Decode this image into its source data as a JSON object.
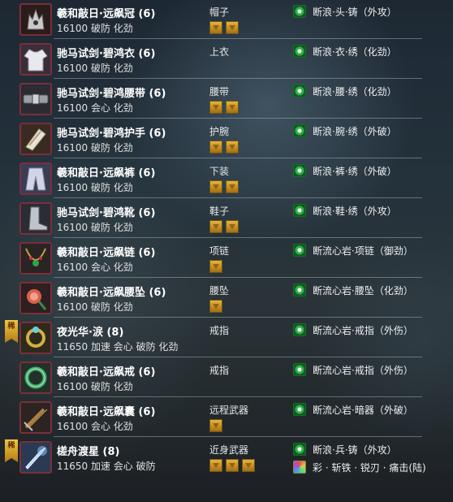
{
  "items": [
    {
      "name": "羲和敲日·远飙冠 (6)",
      "stats": "16100 破防 化劲",
      "slot": "帽子",
      "gems": 2,
      "forge": "断浪·头·铸（外攻）",
      "icon": "crown-helmet-icon",
      "badge": ""
    },
    {
      "name": "驰马试剑·碧鸿衣 (6)",
      "stats": "16100 破防 化劲",
      "slot": "上衣",
      "gems": 0,
      "forge": "断浪·衣·绣（化劲）",
      "icon": "robe-icon",
      "badge": ""
    },
    {
      "name": "驰马试剑·碧鸿腰带 (6)",
      "stats": "16100 会心 化劲",
      "slot": "腰带",
      "gems": 2,
      "forge": "断浪·腰·绣（化劲）",
      "icon": "belt-icon",
      "badge": ""
    },
    {
      "name": "驰马试剑·碧鸿护手 (6)",
      "stats": "16100 破防 化劲",
      "slot": "护腕",
      "gems": 2,
      "forge": "断浪·腕·绣（外破）",
      "icon": "bracer-icon",
      "badge": ""
    },
    {
      "name": "羲和敲日·远飙裤 (6)",
      "stats": "16100 破防 化劲",
      "slot": "下装",
      "gems": 2,
      "forge": "断浪·裤·绣（外破）",
      "icon": "pants-icon",
      "badge": ""
    },
    {
      "name": "驰马试剑·碧鸿靴 (6)",
      "stats": "16100 破防 化劲",
      "slot": "鞋子",
      "gems": 2,
      "forge": "断浪·鞋·绣（外攻）",
      "icon": "boots-icon",
      "badge": ""
    },
    {
      "name": "羲和敲日·远飙链 (6)",
      "stats": "16100 会心 化劲",
      "slot": "项链",
      "gems": 1,
      "forge": "断流心岩·项链（御劲）",
      "icon": "necklace-icon",
      "badge": ""
    },
    {
      "name": "羲和敲日·远飙腰坠 (6)",
      "stats": "16100 破防 化劲",
      "slot": "腰坠",
      "gems": 1,
      "forge": "断流心岩·腰坠（化劲）",
      "icon": "pendant-icon",
      "badge": ""
    },
    {
      "name": "夜光华·涙 (8)",
      "stats": "11650 加速 会心 破防 化劲",
      "slot": "戒指",
      "gems": 0,
      "forge": "断流心岩·戒指（外伤）",
      "icon": "ring-icon",
      "badge": "稀"
    },
    {
      "name": "羲和敲日·远飙戒 (6)",
      "stats": "16100 破防 化劲",
      "slot": "戒指",
      "gems": 0,
      "forge": "断流心岩·戒指（外伤）",
      "icon": "jade-ring-icon",
      "badge": ""
    },
    {
      "name": "羲和敲日·远飙囊 (6)",
      "stats": "16100 会心 化劲",
      "slot": "远程武器",
      "gems": 1,
      "forge": "断流心岩·暗器（外破）",
      "icon": "quiver-icon",
      "badge": ""
    },
    {
      "name": "槎舟渡星 (8)",
      "stats": "11650 加速 会心 破防",
      "slot": "近身武器",
      "gems": 3,
      "forge": "断浪·兵·铸（外攻）",
      "forge2": "彩 · 斩铁 · 锐刃 · 痛击(陆)",
      "icon": "weapon-icon",
      "badge": "稀"
    }
  ]
}
